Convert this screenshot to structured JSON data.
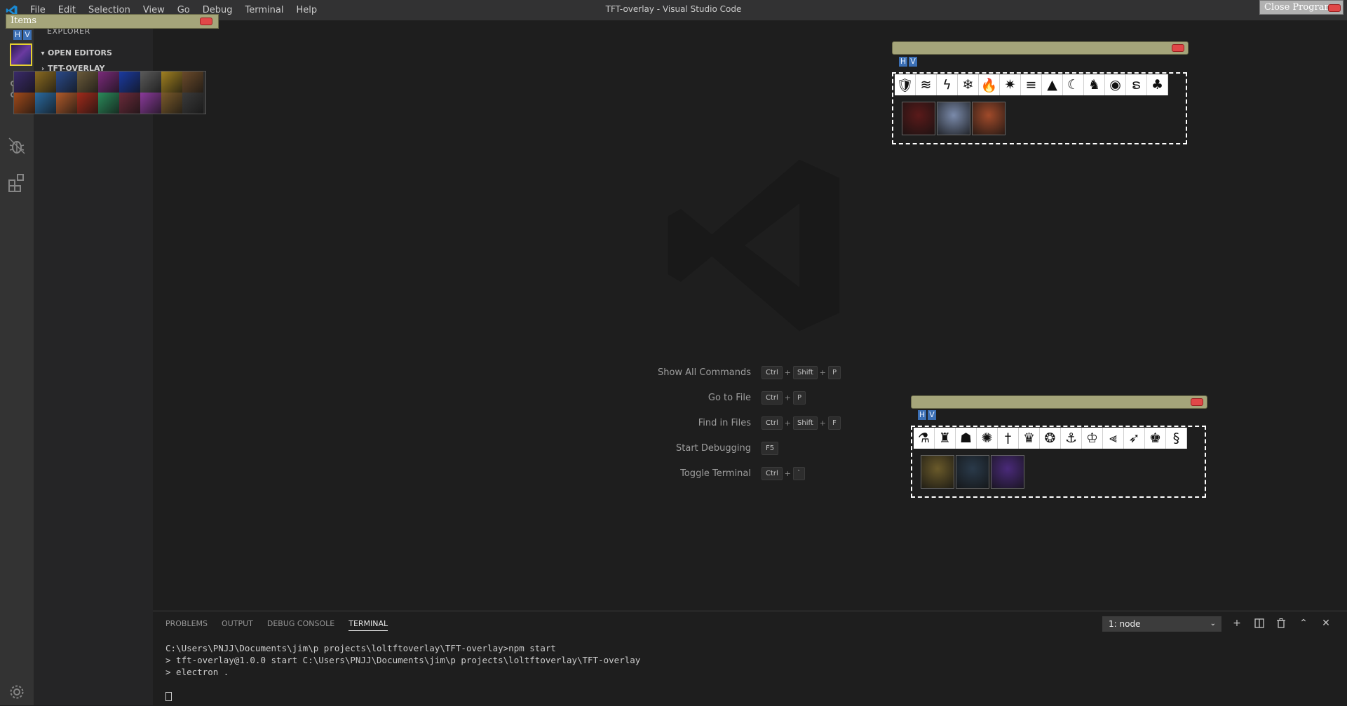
{
  "window": {
    "title": "TFT-overlay - Visual Studio Code"
  },
  "menu": [
    "File",
    "Edit",
    "Selection",
    "View",
    "Go",
    "Debug",
    "Terminal",
    "Help"
  ],
  "sidebar": {
    "title": "EXPLORER",
    "sections": [
      {
        "label": "OPEN EDITORS",
        "expanded": true
      },
      {
        "label": "TFT-OVERLAY",
        "expanded": false
      }
    ]
  },
  "activity_icons": [
    "files-icon",
    "search-icon",
    "source-control-icon",
    "debug-icon",
    "extensions-icon",
    "gear-icon"
  ],
  "shortcuts": [
    {
      "label": "Show All Commands",
      "keys": [
        "Ctrl",
        "Shift",
        "P"
      ]
    },
    {
      "label": "Go to File",
      "keys": [
        "Ctrl",
        "P"
      ]
    },
    {
      "label": "Find in Files",
      "keys": [
        "Ctrl",
        "Shift",
        "F"
      ]
    },
    {
      "label": "Start Debugging",
      "keys": [
        "F5"
      ]
    },
    {
      "label": "Toggle Terminal",
      "keys": [
        "Ctrl",
        "`"
      ]
    }
  ],
  "panel": {
    "tabs": [
      "PROBLEMS",
      "OUTPUT",
      "DEBUG CONSOLE",
      "TERMINAL"
    ],
    "active_tab": "TERMINAL",
    "terminal_select": "1: node",
    "actions": [
      "plus-icon",
      "split-icon",
      "trash-icon",
      "chevron-up-icon",
      "close-icon"
    ],
    "lines": [
      "C:\\Users\\PNJJ\\Documents\\jim\\p projects\\loltftoverlay\\TFT-overlay>npm start",
      "",
      "> tft-overlay@1.0.0 start C:\\Users\\PNJJ\\Documents\\jim\\p projects\\loltftoverlay\\TFT-overlay",
      "> electron ."
    ]
  },
  "overlay": {
    "items_title": "Items",
    "close_program": "Close Program",
    "hv_buttons": [
      "H",
      "V"
    ],
    "items_count": 18,
    "trait_panels": [
      {
        "traits": [
          "🛡",
          "≋",
          "ϟ",
          "❄",
          "🔥",
          "✷",
          "≡",
          "▲",
          "☾",
          "♞",
          "◉",
          "ຣ",
          "♣"
        ],
        "champions": 3
      },
      {
        "traits": [
          "⚗",
          "♜",
          "☗",
          "✺",
          "†",
          "♛",
          "❂",
          "⚓",
          "♔",
          "⫷",
          "➶",
          "♚",
          "§"
        ],
        "champions": 3
      }
    ]
  },
  "colors": {
    "bg": "#1e1e1e",
    "sidebar": "#252526",
    "activitybar": "#333333",
    "overlay_bar": "#a5a57a",
    "hv_blue": "#3b6fb4",
    "close_red": "#e04848"
  }
}
